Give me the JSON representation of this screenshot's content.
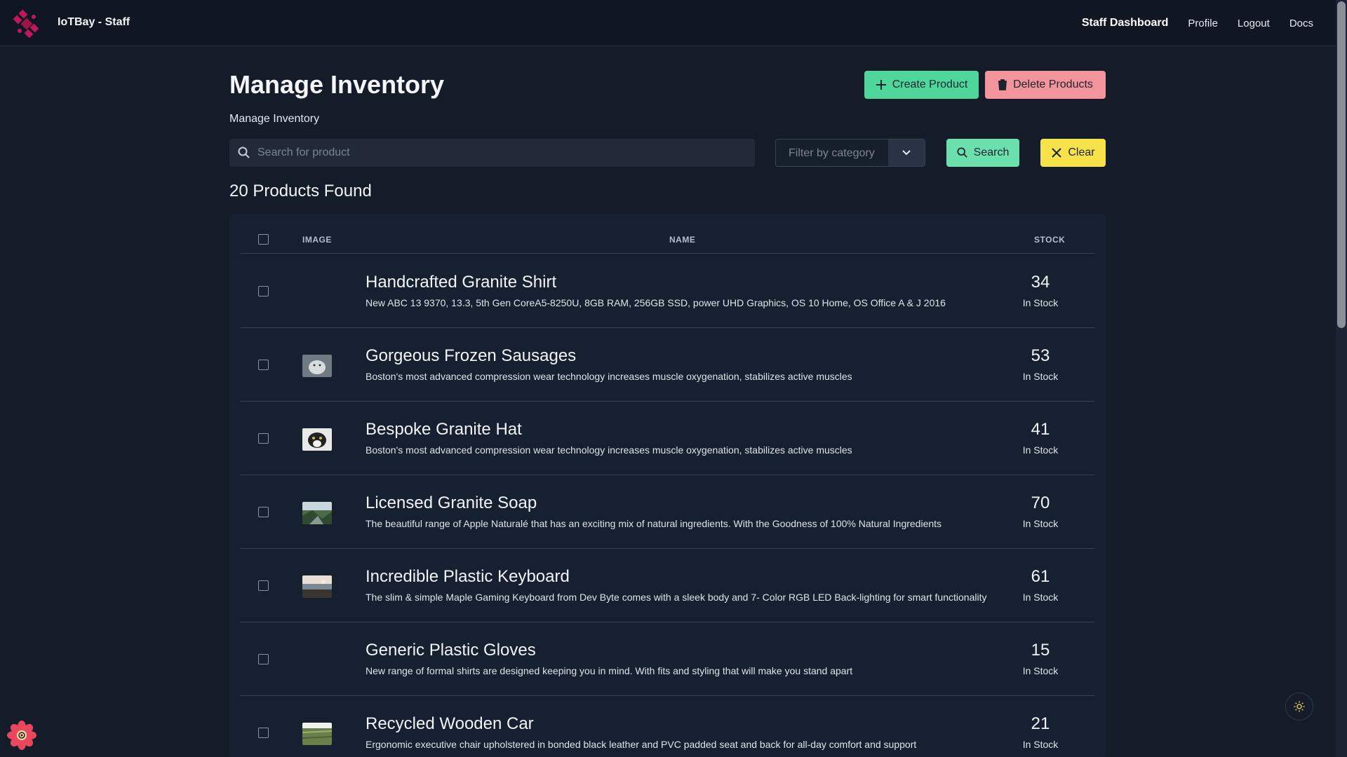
{
  "navbar": {
    "brand": "IoTBay - Staff",
    "links": [
      {
        "label": "Staff Dashboard",
        "active": true
      },
      {
        "label": "Profile",
        "active": false
      },
      {
        "label": "Logout",
        "active": false
      },
      {
        "label": "Docs",
        "active": false
      }
    ]
  },
  "header": {
    "title": "Manage Inventory",
    "subtitle": "Manage Inventory",
    "create_label": "Create Product",
    "delete_label": "Delete Products"
  },
  "toolbar": {
    "search_placeholder": "Search for product",
    "search_value": "",
    "filter_placeholder": "Filter by category",
    "search_label": "Search",
    "clear_label": "Clear"
  },
  "results": {
    "count_text": "20 Products Found"
  },
  "table": {
    "columns": {
      "image": "IMAGE",
      "name": "NAME",
      "stock": "STOCK"
    },
    "rows": [
      {
        "name": "Handcrafted Granite Shirt",
        "description": "New ABC 13 9370, 13.3, 5th Gen CoreA5-8250U, 8GB RAM, 256GB SSD, power UHD Graphics, OS 10 Home, OS Office A & J 2016",
        "stock": "34",
        "stock_label": "In Stock",
        "thumb": "none"
      },
      {
        "name": "Gorgeous Frozen Sausages",
        "description": "Boston's most advanced compression wear technology increases muscle oxygenation, stabilizes active muscles",
        "stock": "53",
        "stock_label": "In Stock",
        "thumb": "cat-grey"
      },
      {
        "name": "Bespoke Granite Hat",
        "description": "Boston's most advanced compression wear technology increases muscle oxygenation, stabilizes active muscles",
        "stock": "41",
        "stock_label": "In Stock",
        "thumb": "cat-bw"
      },
      {
        "name": "Licensed Granite Soap",
        "description": "The beautiful range of Apple Naturalé that has an exciting mix of natural ingredients. With the Goodness of 100% Natural Ingredients",
        "stock": "70",
        "stock_label": "In Stock",
        "thumb": "landscape-valley"
      },
      {
        "name": "Incredible Plastic Keyboard",
        "description": "The slim & simple Maple Gaming Keyboard from Dev Byte comes with a sleek body and 7- Color RGB LED Back-lighting for smart functionality",
        "stock": "61",
        "stock_label": "In Stock",
        "thumb": "landscape-sunset"
      },
      {
        "name": "Generic Plastic Gloves",
        "description": "New range of formal shirts are designed keeping you in mind. With fits and styling that will make you stand apart",
        "stock": "15",
        "stock_label": "In Stock",
        "thumb": "none"
      },
      {
        "name": "Recycled Wooden Car",
        "description": "Ergonomic executive chair upholstered in bonded black leather and PVC padded seat and back for all-day comfort and support",
        "stock": "21",
        "stock_label": "In Stock",
        "thumb": "landscape-field"
      }
    ]
  },
  "colors": {
    "background": "#141b29",
    "navbar": "#111722",
    "panel": "#172030",
    "create_button": "#4ed69b",
    "delete_button": "#f3949c",
    "search_button": "#6be0ac",
    "clear_button": "#f7e24a",
    "brand_logo": "#c2185b"
  }
}
